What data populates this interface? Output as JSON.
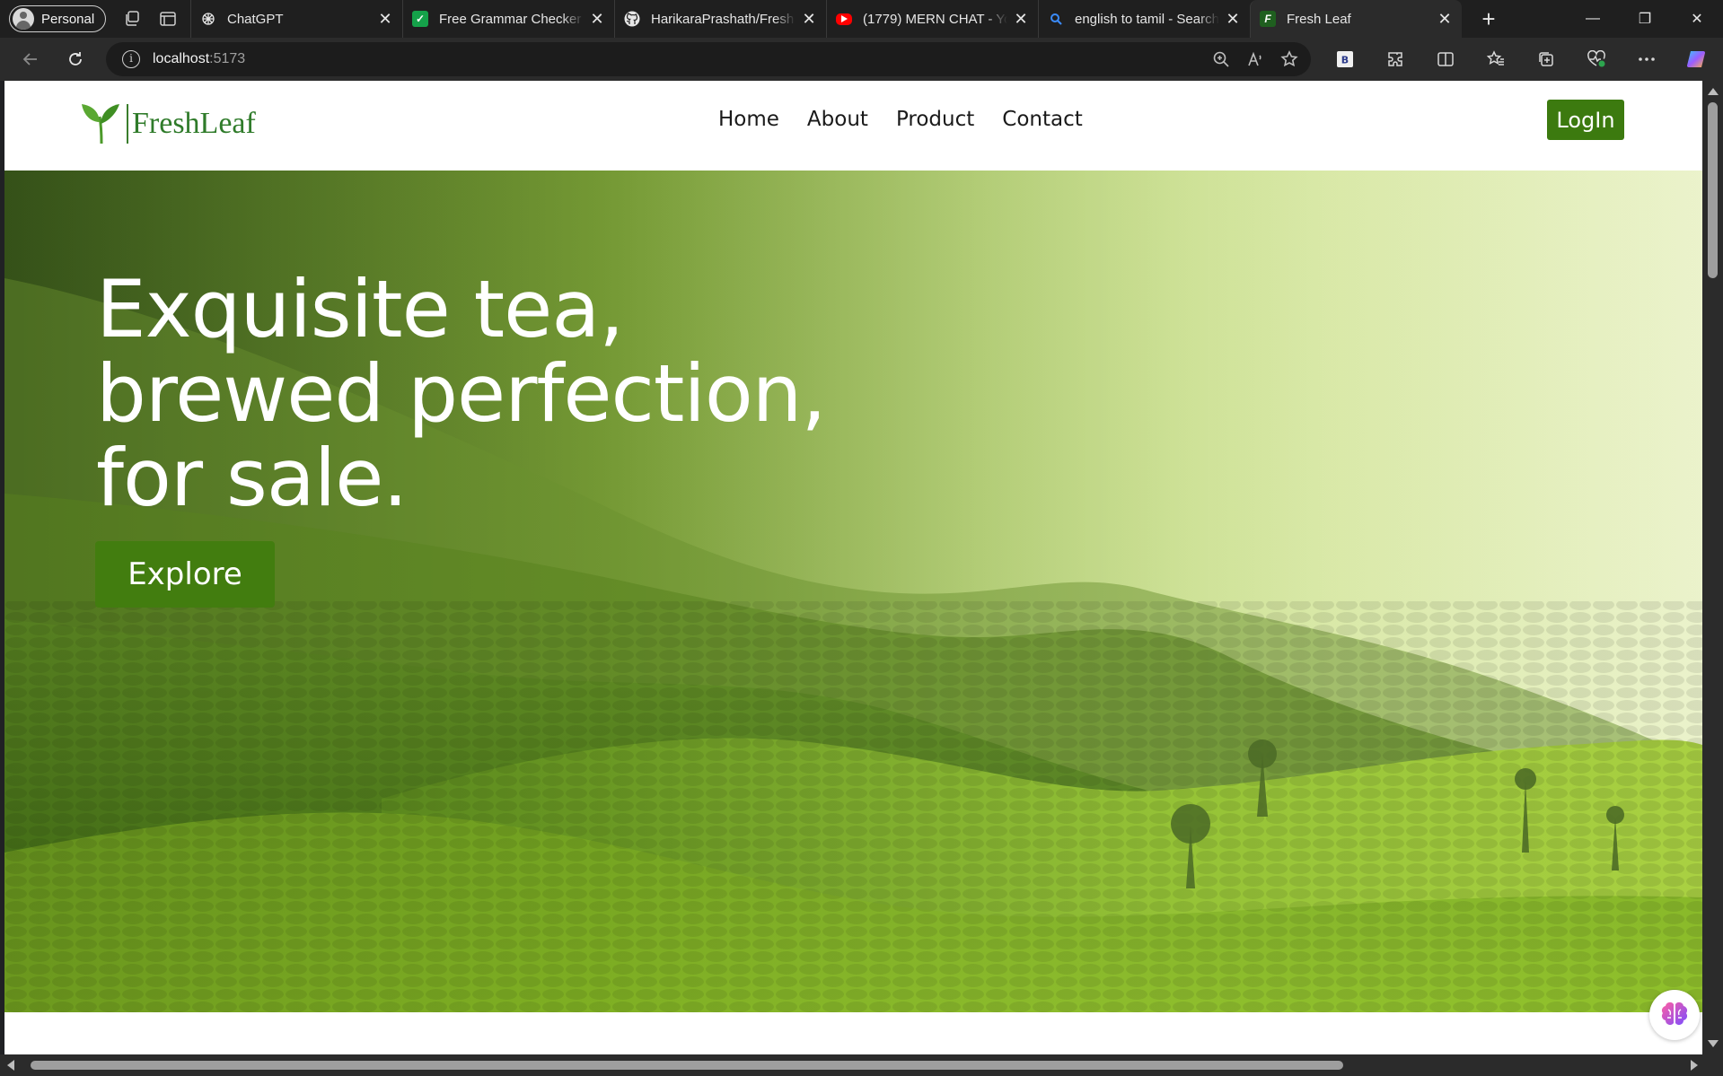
{
  "browser": {
    "profile_label": "Personal",
    "tabs": [
      {
        "title": "ChatGPT",
        "favicon": "chatgpt-icon",
        "color": "#1f1f1f"
      },
      {
        "title": "Free Grammar Checker (",
        "favicon": "grammar-icon",
        "color": "#15a24a"
      },
      {
        "title": "HarikaraPrashath/Fresh",
        "favicon": "github-icon",
        "color": "#1f1f1f"
      },
      {
        "title": "(1779) MERN CHAT - Yo",
        "favicon": "youtube-icon",
        "color": "#ff0000"
      },
      {
        "title": "english to tamil - Search",
        "favicon": "search-icon",
        "color": "#1f1f1f"
      },
      {
        "title": "Fresh Leaf",
        "favicon": "freshleaf-icon",
        "color": "#1f5f1f",
        "active": true
      }
    ],
    "address": {
      "host": "localhost",
      "port": ":5173"
    }
  },
  "site": {
    "logo_text": "FreshLeaf",
    "nav": [
      "Home",
      "About",
      "Product",
      "Contact"
    ],
    "login_label": "LogIn",
    "brand_color": "#427d0f",
    "hero": {
      "headline_lines": [
        "Exquisite tea,",
        "brewed perfection,",
        "for sale."
      ],
      "cta_label": "Explore"
    }
  }
}
